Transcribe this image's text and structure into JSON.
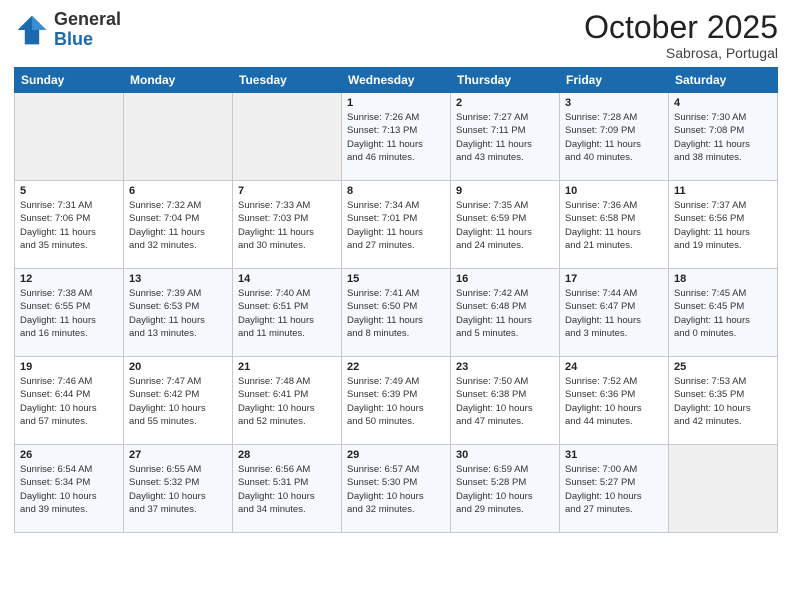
{
  "header": {
    "logo_general": "General",
    "logo_blue": "Blue",
    "month_title": "October 2025",
    "location": "Sabrosa, Portugal"
  },
  "days_of_week": [
    "Sunday",
    "Monday",
    "Tuesday",
    "Wednesday",
    "Thursday",
    "Friday",
    "Saturday"
  ],
  "weeks": [
    [
      {
        "day": "",
        "info": ""
      },
      {
        "day": "",
        "info": ""
      },
      {
        "day": "",
        "info": ""
      },
      {
        "day": "1",
        "info": "Sunrise: 7:26 AM\nSunset: 7:13 PM\nDaylight: 11 hours\nand 46 minutes."
      },
      {
        "day": "2",
        "info": "Sunrise: 7:27 AM\nSunset: 7:11 PM\nDaylight: 11 hours\nand 43 minutes."
      },
      {
        "day": "3",
        "info": "Sunrise: 7:28 AM\nSunset: 7:09 PM\nDaylight: 11 hours\nand 40 minutes."
      },
      {
        "day": "4",
        "info": "Sunrise: 7:30 AM\nSunset: 7:08 PM\nDaylight: 11 hours\nand 38 minutes."
      }
    ],
    [
      {
        "day": "5",
        "info": "Sunrise: 7:31 AM\nSunset: 7:06 PM\nDaylight: 11 hours\nand 35 minutes."
      },
      {
        "day": "6",
        "info": "Sunrise: 7:32 AM\nSunset: 7:04 PM\nDaylight: 11 hours\nand 32 minutes."
      },
      {
        "day": "7",
        "info": "Sunrise: 7:33 AM\nSunset: 7:03 PM\nDaylight: 11 hours\nand 30 minutes."
      },
      {
        "day": "8",
        "info": "Sunrise: 7:34 AM\nSunset: 7:01 PM\nDaylight: 11 hours\nand 27 minutes."
      },
      {
        "day": "9",
        "info": "Sunrise: 7:35 AM\nSunset: 6:59 PM\nDaylight: 11 hours\nand 24 minutes."
      },
      {
        "day": "10",
        "info": "Sunrise: 7:36 AM\nSunset: 6:58 PM\nDaylight: 11 hours\nand 21 minutes."
      },
      {
        "day": "11",
        "info": "Sunrise: 7:37 AM\nSunset: 6:56 PM\nDaylight: 11 hours\nand 19 minutes."
      }
    ],
    [
      {
        "day": "12",
        "info": "Sunrise: 7:38 AM\nSunset: 6:55 PM\nDaylight: 11 hours\nand 16 minutes."
      },
      {
        "day": "13",
        "info": "Sunrise: 7:39 AM\nSunset: 6:53 PM\nDaylight: 11 hours\nand 13 minutes."
      },
      {
        "day": "14",
        "info": "Sunrise: 7:40 AM\nSunset: 6:51 PM\nDaylight: 11 hours\nand 11 minutes."
      },
      {
        "day": "15",
        "info": "Sunrise: 7:41 AM\nSunset: 6:50 PM\nDaylight: 11 hours\nand 8 minutes."
      },
      {
        "day": "16",
        "info": "Sunrise: 7:42 AM\nSunset: 6:48 PM\nDaylight: 11 hours\nand 5 minutes."
      },
      {
        "day": "17",
        "info": "Sunrise: 7:44 AM\nSunset: 6:47 PM\nDaylight: 11 hours\nand 3 minutes."
      },
      {
        "day": "18",
        "info": "Sunrise: 7:45 AM\nSunset: 6:45 PM\nDaylight: 11 hours\nand 0 minutes."
      }
    ],
    [
      {
        "day": "19",
        "info": "Sunrise: 7:46 AM\nSunset: 6:44 PM\nDaylight: 10 hours\nand 57 minutes."
      },
      {
        "day": "20",
        "info": "Sunrise: 7:47 AM\nSunset: 6:42 PM\nDaylight: 10 hours\nand 55 minutes."
      },
      {
        "day": "21",
        "info": "Sunrise: 7:48 AM\nSunset: 6:41 PM\nDaylight: 10 hours\nand 52 minutes."
      },
      {
        "day": "22",
        "info": "Sunrise: 7:49 AM\nSunset: 6:39 PM\nDaylight: 10 hours\nand 50 minutes."
      },
      {
        "day": "23",
        "info": "Sunrise: 7:50 AM\nSunset: 6:38 PM\nDaylight: 10 hours\nand 47 minutes."
      },
      {
        "day": "24",
        "info": "Sunrise: 7:52 AM\nSunset: 6:36 PM\nDaylight: 10 hours\nand 44 minutes."
      },
      {
        "day": "25",
        "info": "Sunrise: 7:53 AM\nSunset: 6:35 PM\nDaylight: 10 hours\nand 42 minutes."
      }
    ],
    [
      {
        "day": "26",
        "info": "Sunrise: 6:54 AM\nSunset: 5:34 PM\nDaylight: 10 hours\nand 39 minutes."
      },
      {
        "day": "27",
        "info": "Sunrise: 6:55 AM\nSunset: 5:32 PM\nDaylight: 10 hours\nand 37 minutes."
      },
      {
        "day": "28",
        "info": "Sunrise: 6:56 AM\nSunset: 5:31 PM\nDaylight: 10 hours\nand 34 minutes."
      },
      {
        "day": "29",
        "info": "Sunrise: 6:57 AM\nSunset: 5:30 PM\nDaylight: 10 hours\nand 32 minutes."
      },
      {
        "day": "30",
        "info": "Sunrise: 6:59 AM\nSunset: 5:28 PM\nDaylight: 10 hours\nand 29 minutes."
      },
      {
        "day": "31",
        "info": "Sunrise: 7:00 AM\nSunset: 5:27 PM\nDaylight: 10 hours\nand 27 minutes."
      },
      {
        "day": "",
        "info": ""
      }
    ]
  ]
}
